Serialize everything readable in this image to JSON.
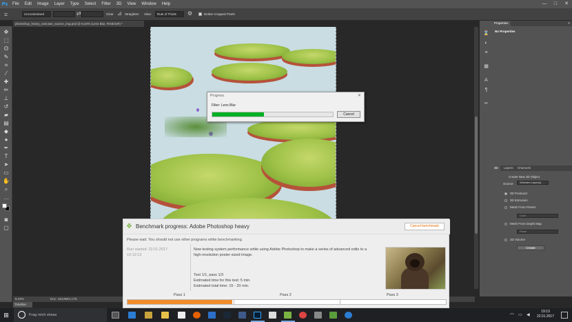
{
  "menubar": {
    "logo": "Ps",
    "items": [
      "File",
      "Edit",
      "Image",
      "Layer",
      "Type",
      "Select",
      "Filter",
      "3D",
      "View",
      "Window",
      "Help"
    ],
    "window_controls": [
      "—",
      "□",
      "✕"
    ]
  },
  "options": {
    "ratio": "Unconstrained",
    "swap": "⇄",
    "clear": "Clear",
    "straighten": "Straighten",
    "view_label": "View:",
    "view": "Rule of Thirds",
    "settings": "⚙",
    "delete_cropped": "Delete Cropped Pixels"
  },
  "document": {
    "tab": "photoshop_heavy_usecase_source_img.psd @ 8,33% (Lens Blur, RGB/16#) *",
    "zoom": "8,33%",
    "doc_size": "Doc: 443,8M/1,17G"
  },
  "timeline": {
    "label": "Timeline"
  },
  "progress_dialog": {
    "title": "Progress",
    "close": "✕",
    "filter": "Filter: Lens Blur",
    "cancel": "Cancel",
    "progress": 0.43
  },
  "properties_panel": {
    "tab": "Properties",
    "content": "No Properties",
    "menu": "≡"
  },
  "panel_3d": {
    "tabs": [
      "3D",
      "Layers",
      "Channels"
    ],
    "header": "Create New 3D Object",
    "source_label": "Source:",
    "source_value": "Selected Layer(s)",
    "options": [
      {
        "label": "3D Postcard",
        "selected": true
      },
      {
        "label": "3D Extrusion",
        "selected": false
      },
      {
        "label": "Mesh From Preset",
        "selected": false
      },
      {
        "label": "Mesh From Depth Map",
        "selected": false
      },
      {
        "label": "3D Volume",
        "selected": false
      }
    ],
    "preset_value": "Cone",
    "depth_value": "Plane",
    "create": "Create"
  },
  "benchmark": {
    "title": "Benchmark progress: Adobe Photoshop heavy",
    "cancel": "Cancel benchmark",
    "wait": "Please wait. You should not use other programs while benchmarking.",
    "run_started_label": "Run started: 22.01.2017",
    "run_started_time": "19:12:13",
    "description": "Now testing system performance while using Adobe Photoshop to make a series of advanced edits to a high-resolution poster-sized image.",
    "test": "Test 1/1, pass 1/3",
    "est_test": "Estimated time for this test: 5 min.",
    "est_total": "Estimated total time: 15 - 20 min.",
    "passes": [
      "Pass 1",
      "Pass 2",
      "Pass 3"
    ],
    "progress": 0.33,
    "accent": "#f28c2a"
  },
  "taskbar": {
    "start": "⊞",
    "search_placeholder": "Frag mich etwas",
    "time": "19:13",
    "date": "22.01.2017"
  }
}
